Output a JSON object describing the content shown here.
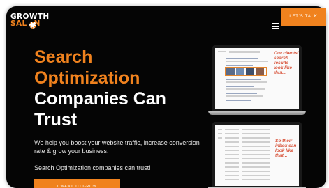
{
  "logo": {
    "line1": "GROWTH",
    "line2": "SAL",
    "line2_end": "N"
  },
  "nav": {
    "cta_label": "LET'S TALK"
  },
  "hero": {
    "title_line1": "Search",
    "title_line2": "Optimization",
    "title_line3": "Companies Can",
    "title_line4": "Trust",
    "subtitle": "We help you boost your website traffic, increase conversion rate & grow your business.",
    "tagline": "Search Optimization companies can trust!",
    "cta_label": "I WANT TO GROW"
  },
  "mockups": {
    "annotation1": "Our clients' search results look like this...",
    "annotation2": "So their inbox can look like that..."
  },
  "colors": {
    "accent": "#f0821e",
    "background": "#050505",
    "text": "#ffffff"
  },
  "icons": {
    "menu": "hamburger-icon",
    "logo_gear": "gear-icon"
  }
}
